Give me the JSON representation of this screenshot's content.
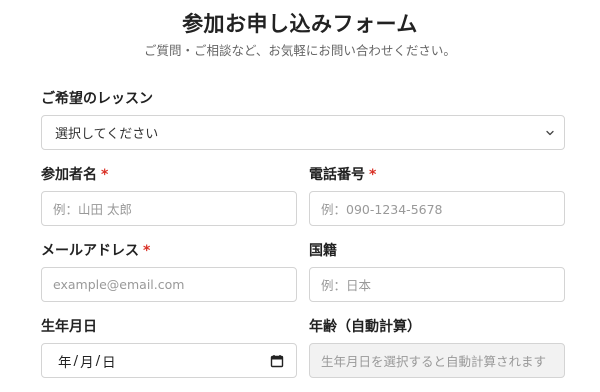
{
  "form": {
    "title": "参加お申し込みフォーム",
    "subtitle": "ご質問・ご相談など、お気軽にお問い合わせください。"
  },
  "lesson": {
    "label": "ご希望のレッスン",
    "selected": "選択してください"
  },
  "name": {
    "label": "参加者名",
    "required": "*",
    "placeholder": "例：山田 太郎"
  },
  "phone": {
    "label": "電話番号",
    "required": "*",
    "placeholder": "例：090-1234-5678"
  },
  "email": {
    "label": "メールアドレス",
    "required": "*",
    "placeholder": "example@email.com"
  },
  "nationality": {
    "label": "国籍",
    "placeholder": "例：日本"
  },
  "birthdate": {
    "label": "生年月日",
    "year": "年",
    "month": "月",
    "day": "日",
    "separator": "/"
  },
  "age": {
    "label": "年齢（自動計算）",
    "placeholder": "生年月日を選択すると自動計算されます"
  }
}
